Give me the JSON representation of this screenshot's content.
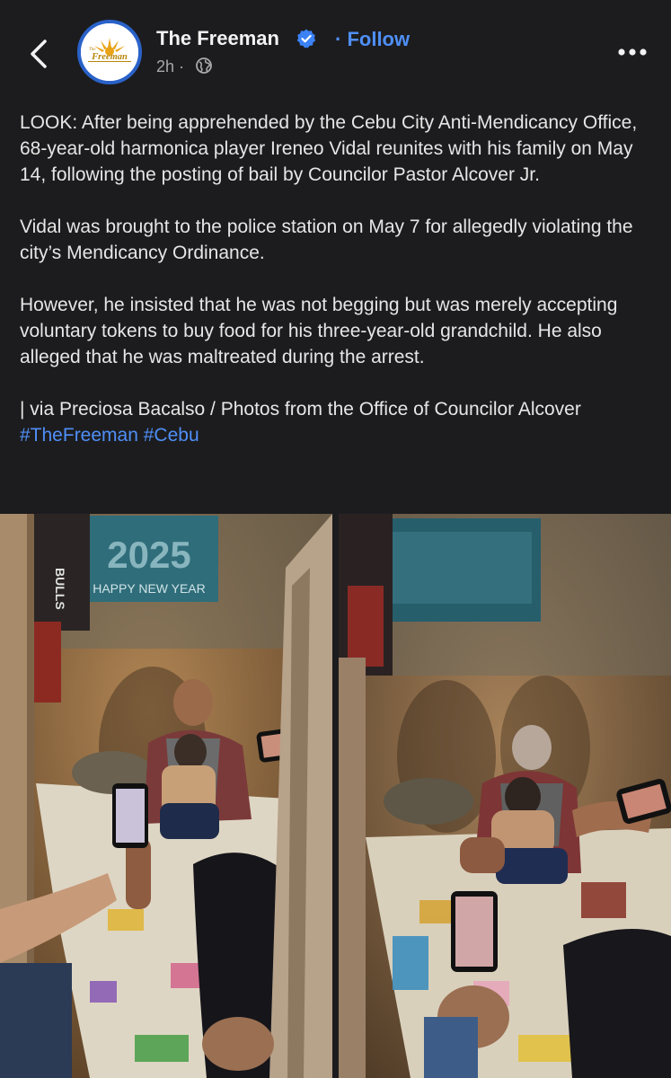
{
  "header": {
    "page_name": "The Freeman",
    "follow_label": "Follow",
    "time": "2h",
    "separator": "·",
    "avatar_text": "Freeman",
    "avatar_prefix": "The",
    "icons": [
      "back-chevron-icon",
      "verified-badge-icon",
      "globe-icon",
      "more-dots-icon"
    ]
  },
  "post": {
    "paragraph1": "LOOK: After being apprehended by the Cebu City Anti-Mendicancy Office, 68-year-old harmonica player Ireneo Vidal reunites with his family on May 14, following the posting of bail by Councilor Pastor Alcover Jr.",
    "paragraph2": "Vidal was brought to the police station on May 7 for allegedly violating the city’s Mendicancy Ordinance.",
    "paragraph3": "However, he insisted that he was not begging but was merely accepting voluntary tokens to buy food for his three-year-old grandchild. He also alleged that he was maltreated during the arrest.",
    "credit": "| via Preciosa Bacalso / Photos from the Office of Councilor Alcover",
    "hashtags": [
      "#TheFreeman",
      "#Cebu"
    ]
  },
  "photos": {
    "photo1": {
      "poster_year": "2025",
      "poster_caption": "HAPPY NEW YEAR",
      "shirt_text": "BULLS"
    }
  },
  "colors": {
    "background": "#1c1c1e",
    "link": "#4f8ff7",
    "verified": "#3b82f6",
    "avatar_ring": "#2a62c9"
  }
}
